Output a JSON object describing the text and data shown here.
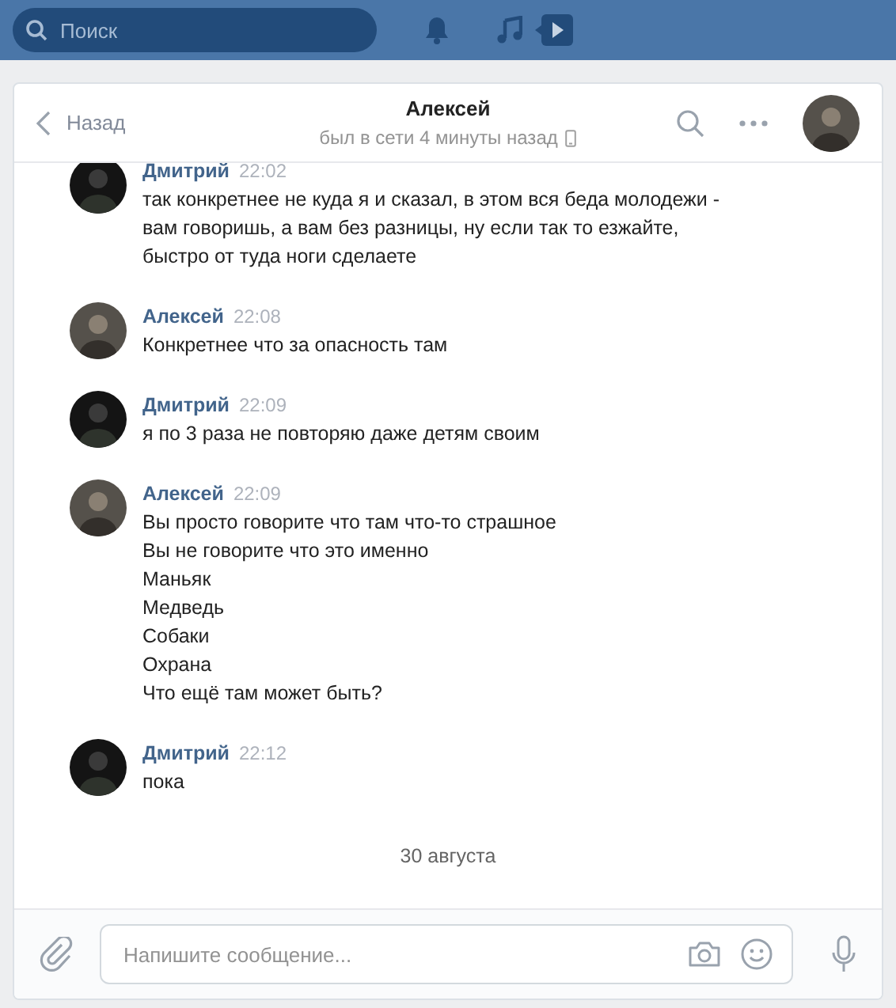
{
  "topbar": {
    "search": {
      "placeholder": "Поиск"
    }
  },
  "header": {
    "back": "Назад",
    "name": "Алексей",
    "status": "был в сети 4 минуты назад"
  },
  "messages": [
    {
      "author": "Дмитрий",
      "time": "22:02",
      "kind": "dark",
      "lines": [
        "так конкретнее не куда я и сказал, в этом вся беда молодежи -",
        "вам говоришь, а вам без разницы, ну если так то езжайте,",
        "быстро от туда ноги сделаете"
      ]
    },
    {
      "author": "Алексей",
      "time": "22:08",
      "kind": "light",
      "lines": [
        "Конкретнее что за опасность там"
      ]
    },
    {
      "author": "Дмитрий",
      "time": "22:09",
      "kind": "dark",
      "lines": [
        "я по 3 раза не повторяю даже детям своим"
      ]
    },
    {
      "author": "Алексей",
      "time": "22:09",
      "kind": "light",
      "lines": [
        "Вы просто говорите что там что-то страшное",
        "Вы не говорите что это именно",
        "Маньяк",
        "Медведь",
        "Собаки",
        "Охрана",
        "Что ещё там может быть?"
      ]
    },
    {
      "author": "Дмитрий",
      "time": "22:12",
      "kind": "dark",
      "lines": [
        "пока"
      ]
    }
  ],
  "date_divider": "30 августа",
  "composer": {
    "placeholder": "Напишите сообщение..."
  }
}
